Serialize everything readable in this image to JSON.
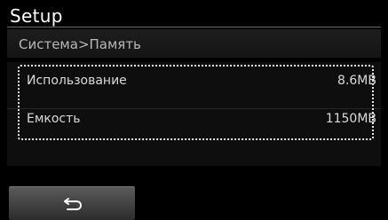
{
  "header": {
    "title": "Setup"
  },
  "breadcrumb": {
    "text": "Система>Память"
  },
  "memory": {
    "items": [
      {
        "label": "Использование",
        "value": "8.6MB"
      },
      {
        "label": "Емкость",
        "value": "1150MB"
      }
    ]
  },
  "footer": {
    "back_icon": "return-arrow-icon"
  },
  "colors": {
    "background": "#000000",
    "text": "#ffffff",
    "muted_text": "#b8b8b8",
    "focus_border": "#e8e8e8",
    "button": "#4a4a4a"
  }
}
